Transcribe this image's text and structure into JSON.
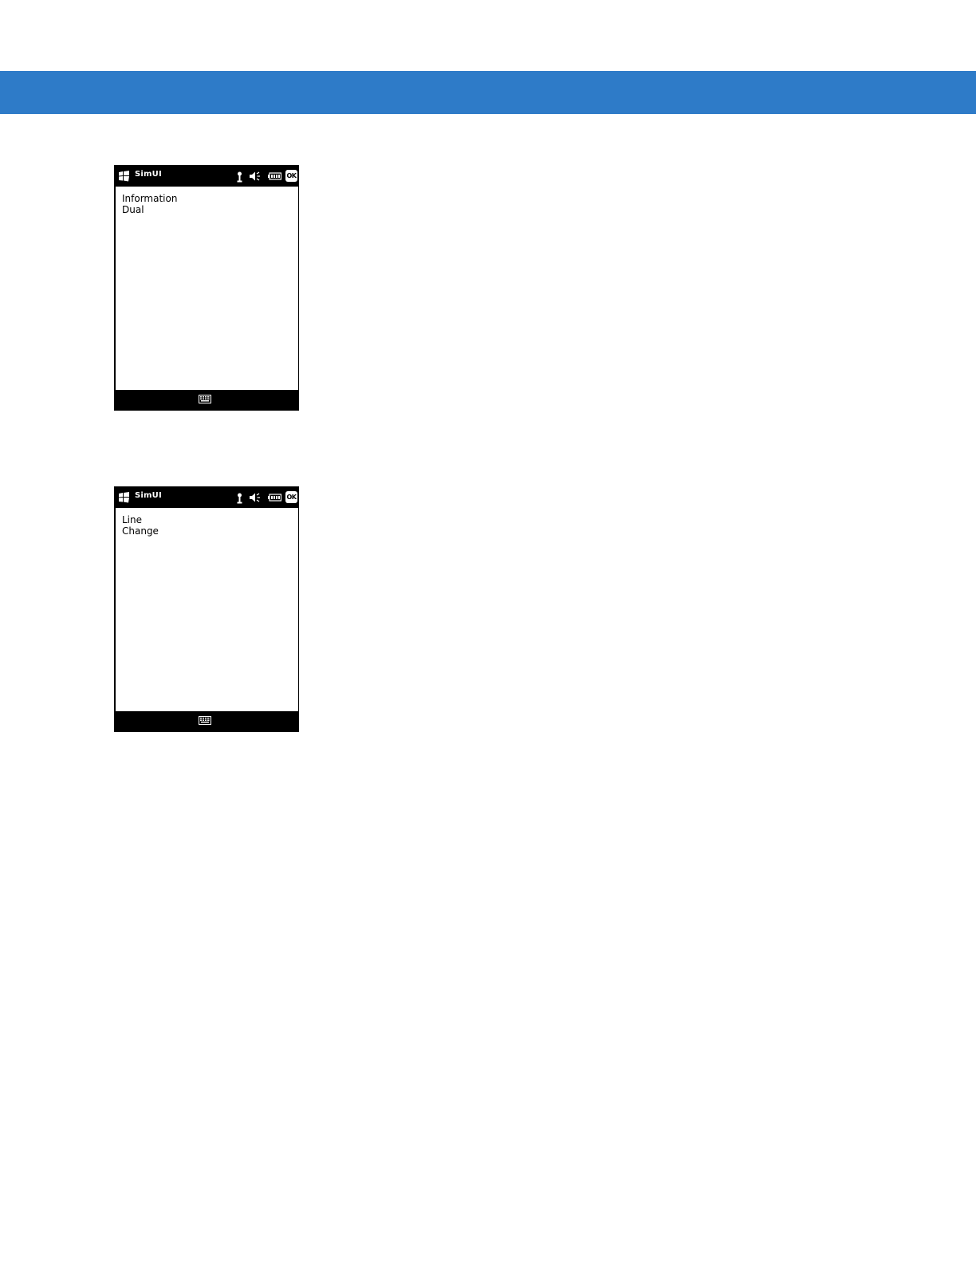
{
  "screens": [
    {
      "title": "SimUI",
      "ok_label": "OK",
      "lines": [
        "Information",
        "Dual"
      ],
      "icons": [
        "windows-start-icon",
        "signal-icon",
        "volume-muted-icon",
        "battery-icon",
        "keyboard-icon"
      ]
    },
    {
      "title": "SimUI",
      "ok_label": "OK",
      "lines": [
        "Line",
        "Change"
      ],
      "icons": [
        "windows-start-icon",
        "signal-icon",
        "volume-muted-icon",
        "battery-icon",
        "keyboard-icon"
      ]
    }
  ],
  "colors": {
    "banner": "#2e7bc8",
    "device_chrome": "#000000",
    "content_background": "#ffffff"
  }
}
